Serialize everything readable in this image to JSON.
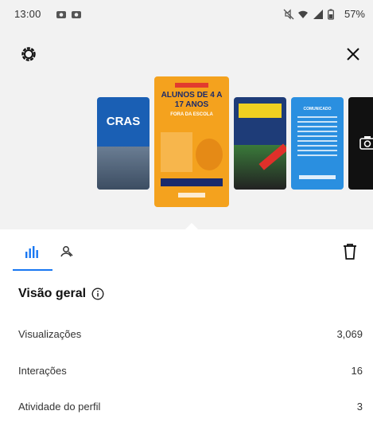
{
  "status_bar": {
    "time": "13:00",
    "battery": "57%",
    "icons": [
      "photo-notification-icon",
      "photo-notification-icon",
      "mute-icon",
      "wifi-icon",
      "signal-icon",
      "battery-icon"
    ]
  },
  "preview": {
    "thumbnails": [
      {
        "title": "CRAS",
        "color": "#1a5fb4"
      },
      {
        "title": "ALUNOS DE 4 A 17 ANOS",
        "subtitle": "FORA DA ESCOLA",
        "color": "#f4a21e"
      },
      {
        "title": "",
        "color": "#1e3c78"
      },
      {
        "title": "COMUNICADO",
        "color": "#2a8fe0"
      },
      {
        "title": "",
        "color": "#111111"
      }
    ]
  },
  "tabs": {
    "items": [
      {
        "icon": "bar-chart-icon",
        "selected": true
      },
      {
        "icon": "person-tag-icon",
        "selected": false
      }
    ],
    "accent": "#1877f2"
  },
  "overview": {
    "title": "Visão geral",
    "rows": [
      {
        "label": "Visualizações",
        "value": "3,069"
      },
      {
        "label": "Interações",
        "value": "16"
      },
      {
        "label": "Atividade do perfil",
        "value": "3"
      }
    ]
  }
}
